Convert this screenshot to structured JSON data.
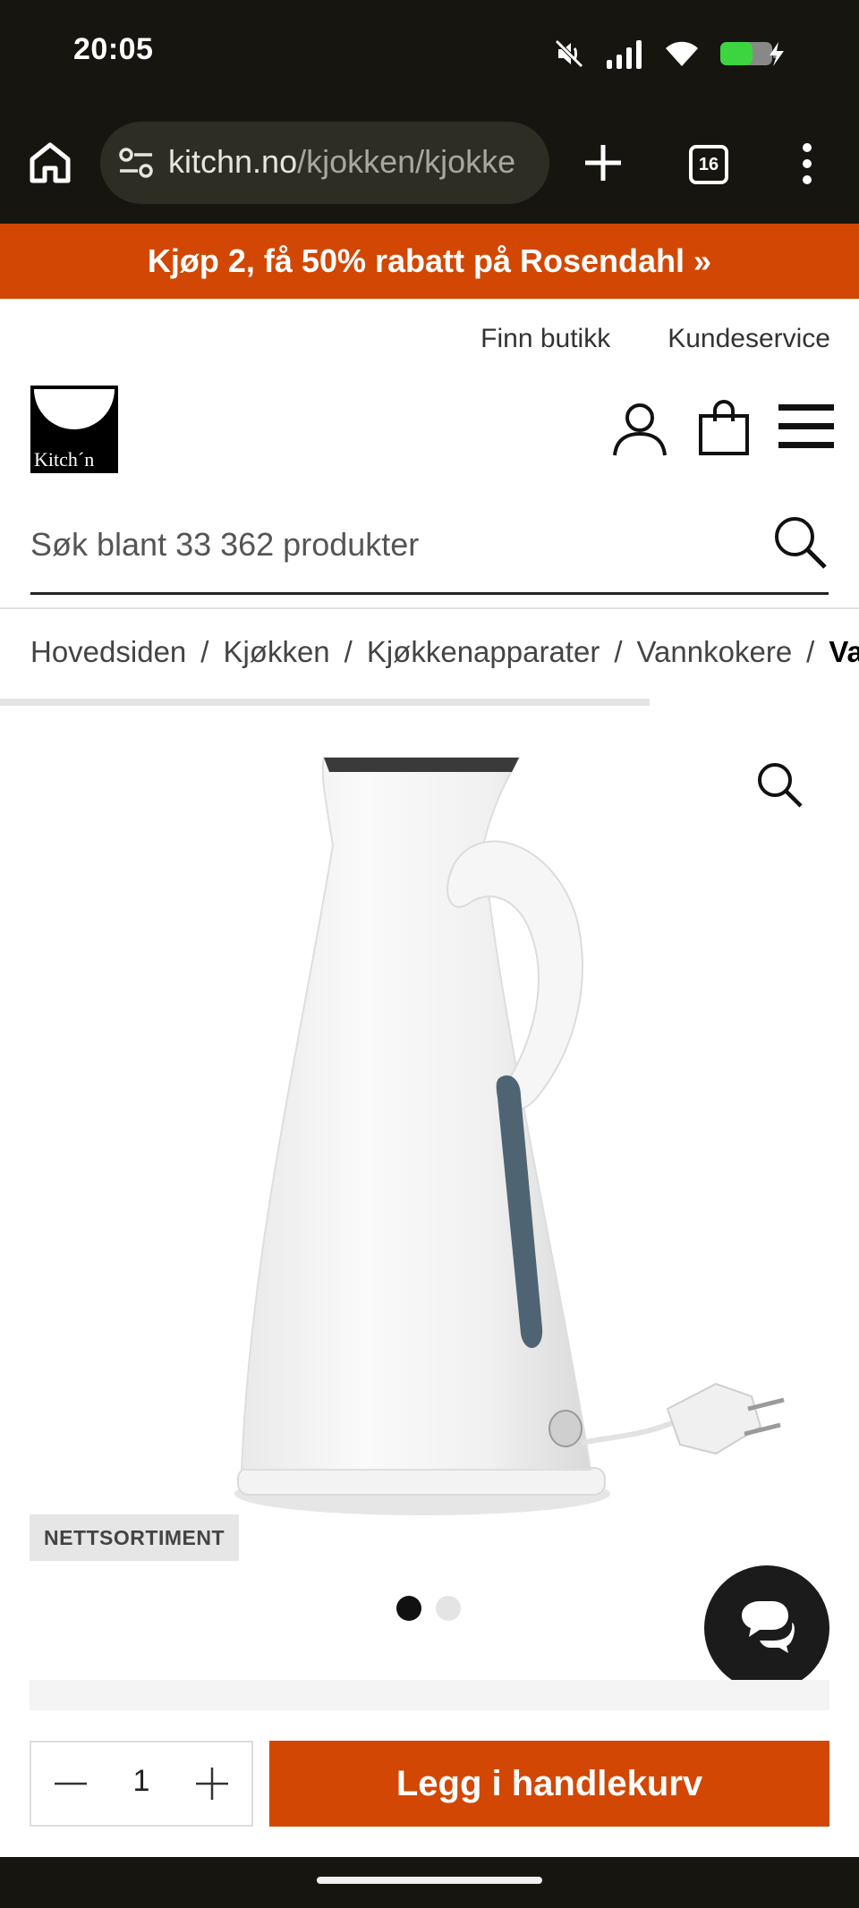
{
  "status_bar": {
    "time": "20:05",
    "icons": [
      "mute-icon",
      "signal-icon",
      "wifi-icon",
      "battery-charging-icon"
    ]
  },
  "browser": {
    "url_domain": "kitchn.no",
    "url_path": "/kjokken/kjokke",
    "tab_count": "16"
  },
  "promo": {
    "text": "Kjøp 2, få 50% rabatt på Rosendahl »"
  },
  "top_links": {
    "find_store": "Finn butikk",
    "customer_service": "Kundeservice"
  },
  "logo": {
    "text": "Kitch´n"
  },
  "search": {
    "placeholder": "Søk blant 33 362 produkter"
  },
  "breadcrumb": {
    "items": [
      "Hovedsiden",
      "Kjøkken",
      "Kjøkkenapparater",
      "Vannkokere"
    ],
    "current": "Va",
    "separator": "/"
  },
  "product": {
    "badge": "NETTSORTIMENT",
    "image_count": 2,
    "active_image": 1
  },
  "cart": {
    "quantity": "1",
    "add_label": "Legg i handlekurv"
  },
  "colors": {
    "brand_orange": "#d24703",
    "dark_bar": "#16150f"
  }
}
